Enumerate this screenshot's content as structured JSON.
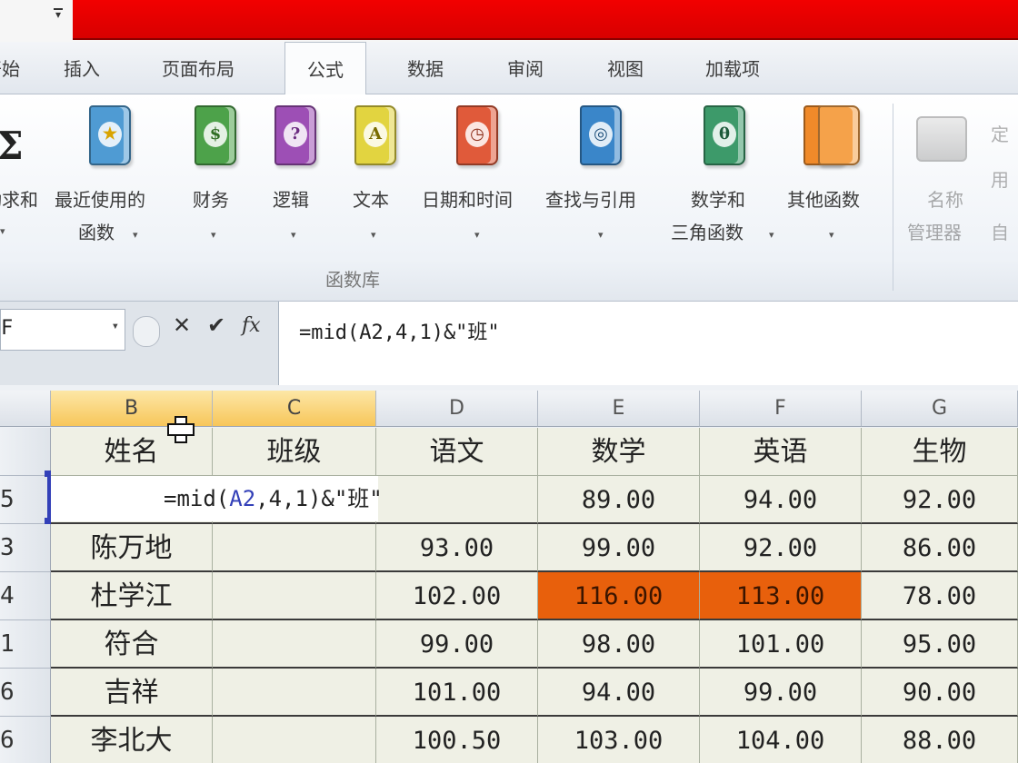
{
  "ribbon_tabs": [
    {
      "label": "开始"
    },
    {
      "label": "插入"
    },
    {
      "label": "页面布局"
    },
    {
      "label": "公式"
    },
    {
      "label": "数据"
    },
    {
      "label": "审阅"
    },
    {
      "label": "视图"
    },
    {
      "label": "加载项"
    }
  ],
  "function_library": {
    "group_label": "函数库",
    "buttons": [
      {
        "line1": "自动求和",
        "line2": "",
        "icon": "sigma-icon"
      },
      {
        "line1": "最近使用的",
        "line2": "函数",
        "icon": "recent-book-icon",
        "color": "#4f9bd3"
      },
      {
        "line1": "财务",
        "line2": "",
        "icon": "finance-book-icon",
        "color": "#4da24a"
      },
      {
        "line1": "逻辑",
        "line2": "",
        "icon": "logical-book-icon",
        "color": "#9d4fb5"
      },
      {
        "line1": "文本",
        "line2": "",
        "icon": "text-book-icon",
        "color": "#e2d440"
      },
      {
        "line1": "日期和时间",
        "line2": "",
        "icon": "date-time-book-icon",
        "color": "#e05a3a"
      },
      {
        "line1": "查找与引用",
        "line2": "",
        "icon": "lookup-book-icon",
        "color": "#3a86c9"
      },
      {
        "line1": "数学和",
        "line2": "三角函数",
        "icon": "math-book-icon",
        "color": "#3d9a6a"
      },
      {
        "line1": "其他函数",
        "line2": "",
        "icon": "more-functions-book-icon",
        "color": "#f08a2a"
      }
    ],
    "glyphs": {
      "recent": "★",
      "finance": "$",
      "logical": "?",
      "text": "A",
      "date": "◷",
      "lookup": "◎",
      "math": "θ"
    }
  },
  "defined_names": {
    "button_line1": "名称",
    "button_line2": "管理器",
    "partial_labels": [
      "定",
      "用",
      "自"
    ]
  },
  "formula_bar": {
    "name_box": "F",
    "cancel_glyph": "✕",
    "enter_glyph": "✔",
    "fx_glyph": "fx",
    "formula": "=mid(A2,4,1)&\"班\""
  },
  "grid": {
    "columns": [
      "B",
      "C",
      "D",
      "E",
      "F",
      "G"
    ],
    "selected_columns": [
      "B",
      "C"
    ],
    "row_numbers": [
      "",
      "5",
      "3",
      "4",
      "1",
      "6",
      "6"
    ],
    "header_row": [
      "姓名",
      "班级",
      "语文",
      "数学",
      "英语",
      "生物"
    ],
    "rows": [
      {
        "name": "",
        "class": "",
        "chinese": "",
        "math": "89.00",
        "english": "94.00",
        "biology": "92.00"
      },
      {
        "name": "陈万地",
        "class": "",
        "chinese": "93.00",
        "math": "99.00",
        "english": "92.00",
        "biology": "86.00"
      },
      {
        "name": "杜学江",
        "class": "",
        "chinese": "102.00",
        "math": "116.00",
        "english": "113.00",
        "biology": "78.00"
      },
      {
        "name": "符合",
        "class": "",
        "chinese": "99.00",
        "math": "98.00",
        "english": "101.00",
        "biology": "95.00"
      },
      {
        "name": "吉祥",
        "class": "",
        "chinese": "101.00",
        "math": "94.00",
        "english": "99.00",
        "biology": "90.00"
      },
      {
        "name": "李北大",
        "class": "",
        "chinese": "100.50",
        "math": "103.00",
        "english": "104.00",
        "biology": "88.00"
      }
    ],
    "edit_cell": {
      "prefix": "=mid(",
      "ref": "A2",
      "suffix": ",4,1)&\"班\""
    },
    "highlight_color": "#e8600c"
  }
}
